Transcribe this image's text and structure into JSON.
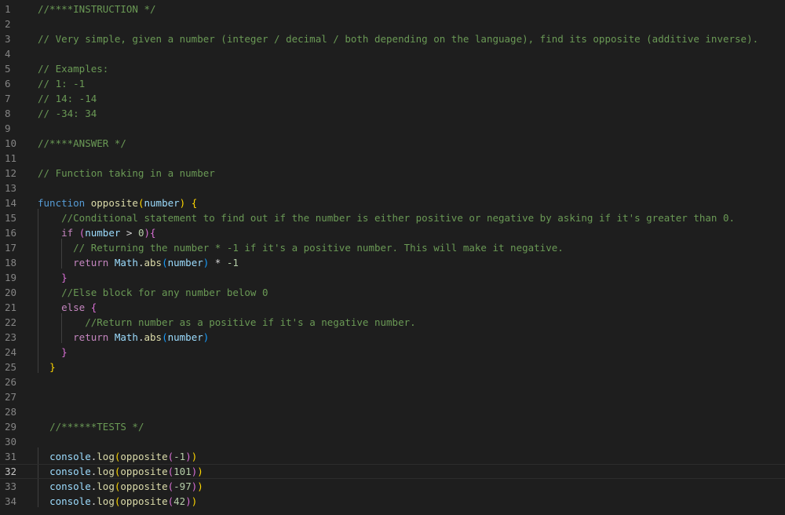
{
  "editor": {
    "active_line": 32,
    "lines": [
      {
        "n": "1",
        "tokens": [
          {
            "t": "//****INSTRUCTION */",
            "c": "c"
          }
        ]
      },
      {
        "n": "2",
        "tokens": []
      },
      {
        "n": "3",
        "tokens": [
          {
            "t": "// Very simple, given a number (integer / decimal / both depending on the language), find its opposite (additive inverse).",
            "c": "c"
          }
        ]
      },
      {
        "n": "4",
        "tokens": []
      },
      {
        "n": "5",
        "tokens": [
          {
            "t": "// Examples:",
            "c": "c"
          }
        ]
      },
      {
        "n": "6",
        "tokens": [
          {
            "t": "// 1: -1",
            "c": "c"
          }
        ]
      },
      {
        "n": "7",
        "tokens": [
          {
            "t": "// 14: -14",
            "c": "c"
          }
        ]
      },
      {
        "n": "8",
        "tokens": [
          {
            "t": "// -34: 34",
            "c": "c"
          }
        ]
      },
      {
        "n": "9",
        "tokens": []
      },
      {
        "n": "10",
        "tokens": [
          {
            "t": "//****ANSWER */",
            "c": "c"
          }
        ]
      },
      {
        "n": "11",
        "tokens": []
      },
      {
        "n": "12",
        "tokens": [
          {
            "t": "// Function taking in a number",
            "c": "c"
          }
        ]
      },
      {
        "n": "13",
        "tokens": []
      },
      {
        "n": "14",
        "tokens": [
          {
            "t": "function",
            "c": "k"
          },
          {
            "t": " ",
            "c": "o"
          },
          {
            "t": "opposite",
            "c": "f"
          },
          {
            "t": "(",
            "c": "b1"
          },
          {
            "t": "number",
            "c": "v"
          },
          {
            "t": ")",
            "c": "b1"
          },
          {
            "t": " ",
            "c": "o"
          },
          {
            "t": "{",
            "c": "b1"
          }
        ]
      },
      {
        "n": "15",
        "tokens": [
          {
            "t": "    ",
            "c": "o"
          },
          {
            "t": "//Conditional statement to find out if the number is either positive or negative by asking if it's greater than 0.",
            "c": "c"
          }
        ]
      },
      {
        "n": "16",
        "tokens": [
          {
            "t": "    ",
            "c": "o"
          },
          {
            "t": "if",
            "c": "kc"
          },
          {
            "t": " ",
            "c": "o"
          },
          {
            "t": "(",
            "c": "b2"
          },
          {
            "t": "number",
            "c": "v"
          },
          {
            "t": " > ",
            "c": "o"
          },
          {
            "t": "0",
            "c": "n"
          },
          {
            "t": ")",
            "c": "b2"
          },
          {
            "t": "{",
            "c": "b2"
          }
        ]
      },
      {
        "n": "17",
        "tokens": [
          {
            "t": "      ",
            "c": "o"
          },
          {
            "t": "// Returning the number * -1 if it's a positive number. This will make it negative.",
            "c": "c"
          }
        ]
      },
      {
        "n": "18",
        "tokens": [
          {
            "t": "      ",
            "c": "o"
          },
          {
            "t": "return",
            "c": "kc"
          },
          {
            "t": " ",
            "c": "o"
          },
          {
            "t": "Math",
            "c": "v"
          },
          {
            "t": ".",
            "c": "o"
          },
          {
            "t": "abs",
            "c": "f"
          },
          {
            "t": "(",
            "c": "b3"
          },
          {
            "t": "number",
            "c": "v"
          },
          {
            "t": ")",
            "c": "b3"
          },
          {
            "t": " * ",
            "c": "o"
          },
          {
            "t": "-1",
            "c": "n"
          }
        ]
      },
      {
        "n": "19",
        "tokens": [
          {
            "t": "    ",
            "c": "o"
          },
          {
            "t": "}",
            "c": "b2"
          }
        ]
      },
      {
        "n": "20",
        "tokens": [
          {
            "t": "    ",
            "c": "o"
          },
          {
            "t": "//Else block for any number below 0",
            "c": "c"
          }
        ]
      },
      {
        "n": "21",
        "tokens": [
          {
            "t": "    ",
            "c": "o"
          },
          {
            "t": "else",
            "c": "kc"
          },
          {
            "t": " ",
            "c": "o"
          },
          {
            "t": "{",
            "c": "b2"
          }
        ]
      },
      {
        "n": "22",
        "tokens": [
          {
            "t": "        ",
            "c": "o"
          },
          {
            "t": "//Return number as a positive if it's a negative number.",
            "c": "c"
          }
        ]
      },
      {
        "n": "23",
        "tokens": [
          {
            "t": "      ",
            "c": "o"
          },
          {
            "t": "return",
            "c": "kc"
          },
          {
            "t": " ",
            "c": "o"
          },
          {
            "t": "Math",
            "c": "v"
          },
          {
            "t": ".",
            "c": "o"
          },
          {
            "t": "abs",
            "c": "f"
          },
          {
            "t": "(",
            "c": "b3"
          },
          {
            "t": "number",
            "c": "v"
          },
          {
            "t": ")",
            "c": "b3"
          }
        ]
      },
      {
        "n": "24",
        "tokens": [
          {
            "t": "    ",
            "c": "o"
          },
          {
            "t": "}",
            "c": "b2"
          }
        ]
      },
      {
        "n": "25",
        "tokens": [
          {
            "t": "  ",
            "c": "o"
          },
          {
            "t": "}",
            "c": "b1"
          }
        ]
      },
      {
        "n": "26",
        "tokens": []
      },
      {
        "n": "27",
        "tokens": []
      },
      {
        "n": "28",
        "tokens": []
      },
      {
        "n": "29",
        "tokens": [
          {
            "t": "  ",
            "c": "o"
          },
          {
            "t": "//******TESTS */",
            "c": "c"
          }
        ]
      },
      {
        "n": "30",
        "tokens": []
      },
      {
        "n": "31",
        "tokens": [
          {
            "t": "  ",
            "c": "o"
          },
          {
            "t": "console",
            "c": "v"
          },
          {
            "t": ".",
            "c": "o"
          },
          {
            "t": "log",
            "c": "f"
          },
          {
            "t": "(",
            "c": "b1"
          },
          {
            "t": "opposite",
            "c": "f"
          },
          {
            "t": "(",
            "c": "b2"
          },
          {
            "t": "-1",
            "c": "n"
          },
          {
            "t": ")",
            "c": "b2"
          },
          {
            "t": ")",
            "c": "b1"
          }
        ]
      },
      {
        "n": "32",
        "tokens": [
          {
            "t": "  ",
            "c": "o"
          },
          {
            "t": "console",
            "c": "v"
          },
          {
            "t": ".",
            "c": "o"
          },
          {
            "t": "log",
            "c": "f"
          },
          {
            "t": "(",
            "c": "b1"
          },
          {
            "t": "opposite",
            "c": "f"
          },
          {
            "t": "(",
            "c": "b2"
          },
          {
            "t": "101",
            "c": "n"
          },
          {
            "t": ")",
            "c": "b2"
          },
          {
            "t": ")",
            "c": "b1"
          }
        ]
      },
      {
        "n": "33",
        "tokens": [
          {
            "t": "  ",
            "c": "o"
          },
          {
            "t": "console",
            "c": "v"
          },
          {
            "t": ".",
            "c": "o"
          },
          {
            "t": "log",
            "c": "f"
          },
          {
            "t": "(",
            "c": "b1"
          },
          {
            "t": "opposite",
            "c": "f"
          },
          {
            "t": "(",
            "c": "b2"
          },
          {
            "t": "-97",
            "c": "n"
          },
          {
            "t": ")",
            "c": "b2"
          },
          {
            "t": ")",
            "c": "b1"
          }
        ]
      },
      {
        "n": "34",
        "tokens": [
          {
            "t": "  ",
            "c": "o"
          },
          {
            "t": "console",
            "c": "v"
          },
          {
            "t": ".",
            "c": "o"
          },
          {
            "t": "log",
            "c": "f"
          },
          {
            "t": "(",
            "c": "b1"
          },
          {
            "t": "opposite",
            "c": "f"
          },
          {
            "t": "(",
            "c": "b2"
          },
          {
            "t": "42",
            "c": "n"
          },
          {
            "t": ")",
            "c": "b2"
          },
          {
            "t": ")",
            "c": "b1"
          }
        ]
      }
    ]
  }
}
